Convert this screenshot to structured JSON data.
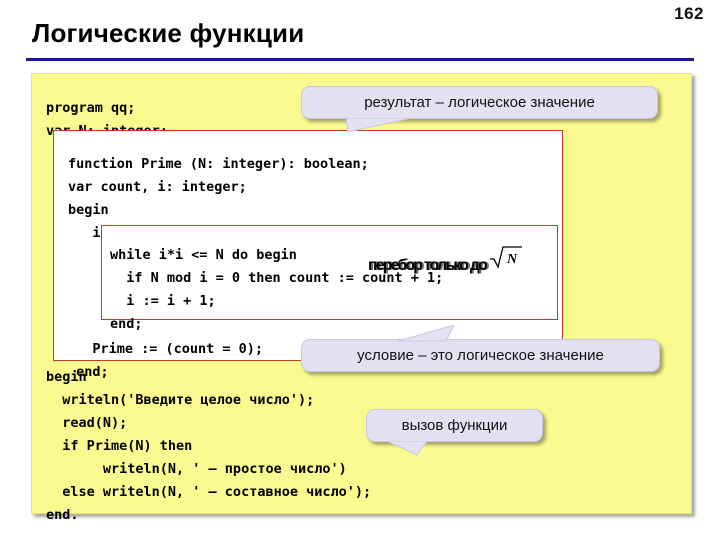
{
  "slide": {
    "page_number": "162",
    "title": "Логические функции"
  },
  "code": {
    "head": "program qq;\nvar N: integer;",
    "function_block": "function Prime (N: integer): boolean;\nvar count, i: integer;\nbegin\n   i := 2; count := 0;",
    "while_block": "while i*i <= N do begin\n  if N mod i = 0 then count := count + 1;\n  i := i + 1;\nend;",
    "function_tail": "   Prime := (count = 0);\n end;",
    "tail": "begin\n  writeln('Введите целое число');\n  read(N);\n  if Prime(N) then\n       writeln(N, ' – простое число')\n  else writeln(N, ' – составное число');\nend."
  },
  "annotations": {
    "sqrt_note_label": "перебор только до",
    "sqrt_note_radicand": "N"
  },
  "callouts": {
    "result": "результат – логическое значение",
    "condition": "условие – это логическое значение",
    "call": "вызов функции"
  },
  "colors": {
    "panel_bg": "#fafa90",
    "panel_border": "#e8e86a",
    "box_border": "#c0392b",
    "box_bg": "#ffffff",
    "callout_bg": "#e3e2f2",
    "rule": "#1a1a8c",
    "text": "#000000"
  }
}
